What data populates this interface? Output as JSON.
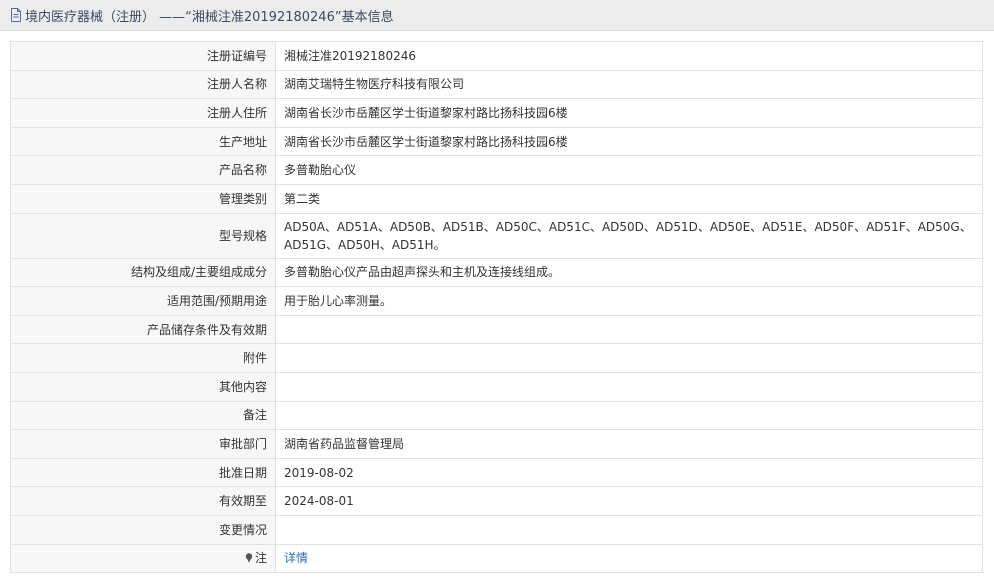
{
  "header": {
    "title": "境内医疗器械（注册） ——“湘械注准20192180246”基本信息",
    "icon": "document-icon"
  },
  "rows": [
    {
      "label": "注册证编号",
      "value": "湘械注准20192180246"
    },
    {
      "label": "注册人名称",
      "value": "湖南艾瑞特生物医疗科技有限公司"
    },
    {
      "label": "注册人住所",
      "value": "湖南省长沙市岳麓区学士街道黎家村路比扬科技园6楼"
    },
    {
      "label": "生产地址",
      "value": "湖南省长沙市岳麓区学士街道黎家村路比扬科技园6楼"
    },
    {
      "label": "产品名称",
      "value": "多普勒胎心仪"
    },
    {
      "label": "管理类别",
      "value": "第二类"
    },
    {
      "label": "型号规格",
      "value": "AD50A、AD51A、AD50B、AD51B、AD50C、AD51C、AD50D、AD51D、AD50E、AD51E、AD50F、AD51F、AD50G、AD51G、AD50H、AD51H。"
    },
    {
      "label": "结构及组成/主要组成成分",
      "value": "多普勒胎心仪产品由超声探头和主机及连接线组成。"
    },
    {
      "label": "适用范围/预期用途",
      "value": "用于胎儿心率测量。"
    },
    {
      "label": "产品储存条件及有效期",
      "value": ""
    },
    {
      "label": "附件",
      "value": ""
    },
    {
      "label": "其他内容",
      "value": ""
    },
    {
      "label": "备注",
      "value": ""
    },
    {
      "label": "审批部门",
      "value": "湖南省药品监督管理局"
    },
    {
      "label": "批准日期",
      "value": "2019-08-02"
    },
    {
      "label": "有效期至",
      "value": "2024-08-01"
    },
    {
      "label": "变更情况",
      "value": ""
    }
  ],
  "note": {
    "label": "注",
    "link_text": "详情",
    "icon": "pin-icon"
  },
  "colors": {
    "link": "#2a6ebb",
    "label_bg": "#f7f7f7",
    "header_bg": "#ececec",
    "header_text": "#3b4a66"
  }
}
